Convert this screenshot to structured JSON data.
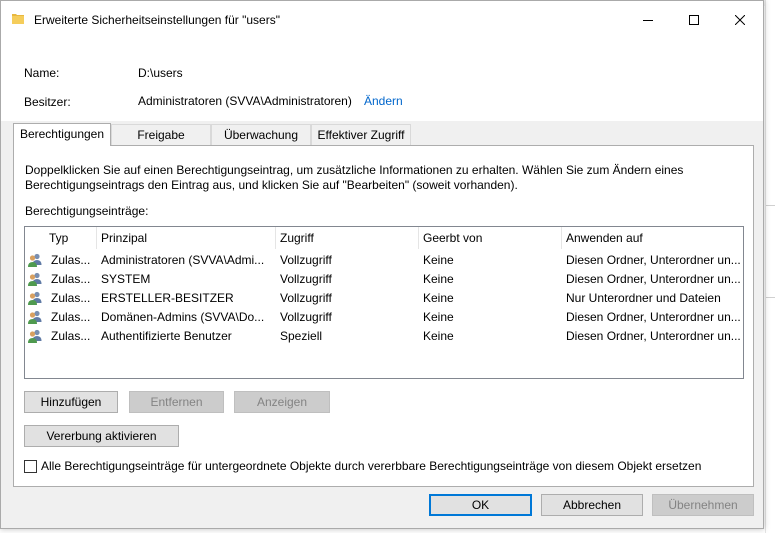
{
  "window": {
    "title": "Erweiterte Sicherheitseinstellungen für \"users\""
  },
  "info": {
    "name_label": "Name:",
    "name_value": "D:\\users",
    "owner_label": "Besitzer:",
    "owner_value": "Administratoren (SVVA\\Administratoren)",
    "owner_change_link": "Ändern"
  },
  "tabs": [
    {
      "label": "Berechtigungen",
      "active": true
    },
    {
      "label": "Freigabe",
      "active": false
    },
    {
      "label": "Überwachung",
      "active": false
    },
    {
      "label": "Effektiver Zugriff",
      "active": false
    }
  ],
  "panel": {
    "description": "Doppelklicken Sie auf einen Berechtigungseintrag, um zusätzliche Informationen zu erhalten. Wählen Sie zum Ändern eines Berechtigungseintrags den Eintrag aus, und klicken Sie auf \"Bearbeiten\" (soweit vorhanden).",
    "entries_label": "Berechtigungseinträge:"
  },
  "table": {
    "columns": [
      "Typ",
      "Prinzipal",
      "Zugriff",
      "Geerbt von",
      "Anwenden auf"
    ],
    "rows": [
      {
        "type": "Zulas...",
        "principal": "Administratoren (SVVA\\Admi...",
        "access": "Vollzugriff",
        "inherited": "Keine",
        "applies": "Diesen Ordner, Unterordner un..."
      },
      {
        "type": "Zulas...",
        "principal": "SYSTEM",
        "access": "Vollzugriff",
        "inherited": "Keine",
        "applies": "Diesen Ordner, Unterordner un..."
      },
      {
        "type": "Zulas...",
        "principal": "ERSTELLER-BESITZER",
        "access": "Vollzugriff",
        "inherited": "Keine",
        "applies": "Nur Unterordner und Dateien"
      },
      {
        "type": "Zulas...",
        "principal": "Domänen-Admins (SVVA\\Do...",
        "access": "Vollzugriff",
        "inherited": "Keine",
        "applies": "Diesen Ordner, Unterordner un..."
      },
      {
        "type": "Zulas...",
        "principal": "Authentifizierte Benutzer",
        "access": "Speziell",
        "inherited": "Keine",
        "applies": "Diesen Ordner, Unterordner un..."
      }
    ]
  },
  "buttons": {
    "add": "Hinzufügen",
    "remove": "Entfernen",
    "view": "Anzeigen",
    "enable_inheritance": "Vererbung aktivieren",
    "ok": "OK",
    "cancel": "Abbrechen",
    "apply": "Übernehmen"
  },
  "replace_checkbox_label": "Alle Berechtigungseinträge für untergeordnete Objekte durch vererbbare Berechtigungseinträge von diesem Objekt ersetzen",
  "colors": {
    "accent": "#0078d7",
    "link": "#0066cc",
    "folder_icon": "#e8b83f"
  }
}
